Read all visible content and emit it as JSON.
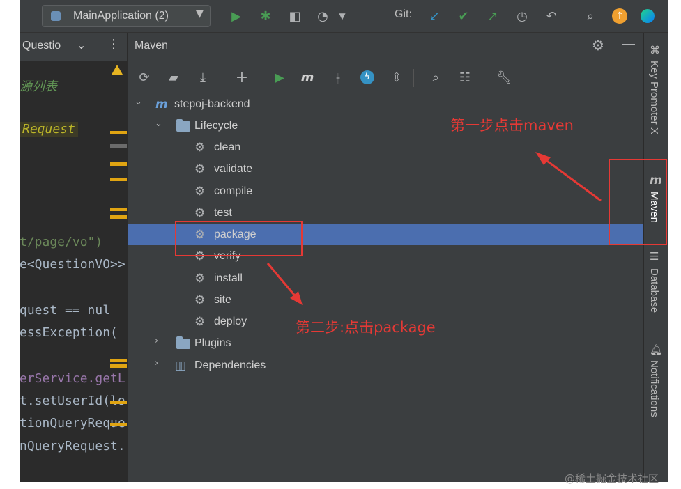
{
  "topbar": {
    "run_config_label": "MainApplication (2)",
    "git_label": "Git:"
  },
  "editor": {
    "tab_label": "Questio",
    "code_lines": [
      {
        "text": "源列表",
        "color": "#629755"
      },
      {
        "text": "Request",
        "color": "#bbb529"
      },
      {
        "text": "t/page/vo\")",
        "color": "#6a8759"
      },
      {
        "text": "e<QuestionVO>>",
        "color": "#a9b7c6"
      },
      {
        "text": "quest == nul",
        "color": "#a9b7c6"
      },
      {
        "text": "essException(",
        "color": "#a9b7c6"
      },
      {
        "text": "erService.getL",
        "color": "#9876aa"
      },
      {
        "text": "t.setUserId(lo",
        "color": "#a9b7c6"
      },
      {
        "text": "tionQueryReque",
        "color": "#a9b7c6"
      },
      {
        "text": "nQueryRequest.",
        "color": "#a9b7c6"
      }
    ]
  },
  "maven": {
    "title": "Maven",
    "project": "stepoj-backend",
    "lifecycle": "Lifecycle",
    "goals": [
      "clean",
      "validate",
      "compile",
      "test",
      "package",
      "verify",
      "install",
      "site",
      "deploy"
    ],
    "selected_goal": "package",
    "plugins": "Plugins",
    "dependencies": "Dependencies"
  },
  "right_strip": {
    "key_promoter": "Key Promoter X",
    "maven": "Maven",
    "database": "Database",
    "notifications": "Notifications"
  },
  "annotations": {
    "step1": "第一步点击maven",
    "step2": "第二步:点击package",
    "color": "#e53935"
  },
  "watermark": "@稀土掘金技术社区",
  "colors": {
    "selection": "#4b6eaf",
    "panel": "#3b3e40",
    "run_green": "#499c54",
    "accent_blue": "#3592c4"
  }
}
